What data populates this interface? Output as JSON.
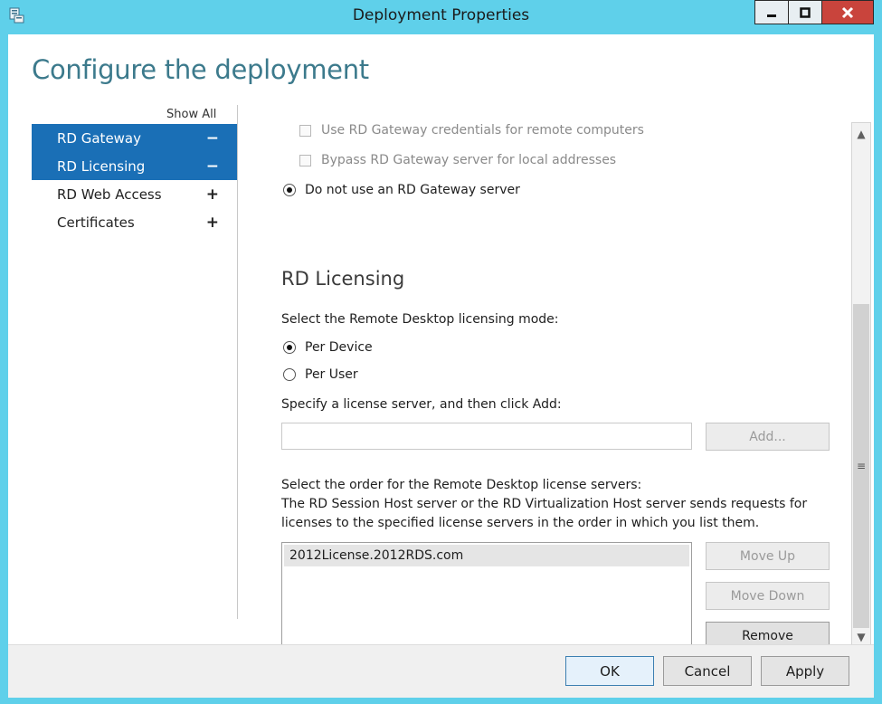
{
  "window": {
    "title": "Deployment Properties",
    "app_icon": "server-manager-icon",
    "controls": {
      "minimize_icon": "minimize-icon",
      "maximize_icon": "maximize-icon",
      "close_icon": "close-icon"
    }
  },
  "page": {
    "heading": "Configure the deployment"
  },
  "nav": {
    "show_all": "Show All",
    "items": [
      {
        "label": "RD Gateway",
        "toggle": "−",
        "selected": true
      },
      {
        "label": "RD Licensing",
        "toggle": "−",
        "selected": true
      },
      {
        "label": "RD Web Access",
        "toggle": "+",
        "selected": false
      },
      {
        "label": "Certificates",
        "toggle": "+",
        "selected": false
      }
    ]
  },
  "gateway": {
    "use_credentials": "Use RD Gateway credentials for remote computers",
    "bypass_local": "Bypass RD Gateway server for local addresses",
    "do_not_use": "Do not use an RD Gateway server"
  },
  "licensing": {
    "title": "RD Licensing",
    "mode_prompt": "Select the Remote Desktop licensing mode:",
    "per_device": "Per Device",
    "per_user": "Per User",
    "selected_mode": "Per Device",
    "server_prompt": "Specify a license server, and then click Add:",
    "server_input_value": "",
    "add_button": "Add...",
    "order_prompt_1": "Select the order for the Remote Desktop license servers:",
    "order_prompt_2": "The RD Session Host server or the RD Virtualization Host server sends requests for",
    "order_prompt_3": "licenses to the specified license servers in the order in which you list them.",
    "servers": [
      "2012License.2012RDS.com"
    ],
    "move_up": "Move Up",
    "move_down": "Move Down",
    "remove": "Remove"
  },
  "footer": {
    "ok": "OK",
    "cancel": "Cancel",
    "apply": "Apply"
  },
  "colors": {
    "titlebar": "#5fd0ea",
    "selection": "#1a6fb6",
    "heading": "#3c7a8c",
    "close_button": "#c9443c"
  }
}
